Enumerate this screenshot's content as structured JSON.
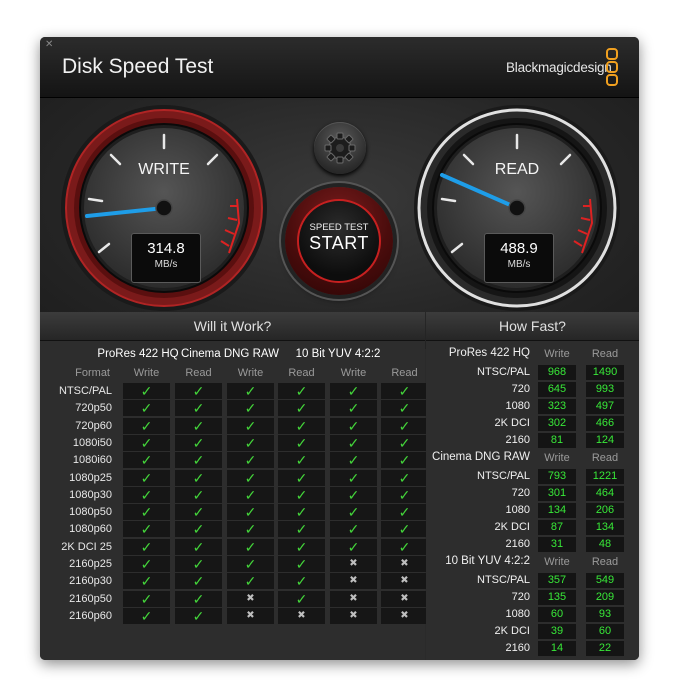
{
  "window": {
    "close_glyph": "✕",
    "title": "Disk Speed Test",
    "brand": "Blackmagicdesign"
  },
  "write_gauge": {
    "label": "WRITE",
    "value": "314.8",
    "unit": "MB/s"
  },
  "read_gauge": {
    "label": "READ",
    "value": "488.9",
    "unit": "MB/s"
  },
  "settings_button": {
    "icon": "gear-icon"
  },
  "start_button": {
    "top_label": "SPEED TEST",
    "label": "START"
  },
  "colors": {
    "accent_red": "#c62020",
    "needle": "#1e9de8",
    "ok_green": "#43d43a",
    "value_green": "#38e838"
  },
  "will_it_work": {
    "title": "Will it Work?",
    "format_header": "Format",
    "groups": [
      "ProRes 422 HQ",
      "Cinema DNG RAW",
      "10 Bit YUV 4:2:2"
    ],
    "subcols": [
      "Write",
      "Read",
      "Write",
      "Read",
      "Write",
      "Read"
    ],
    "check_glyph": "✓",
    "cross_glyph": "✖",
    "rows": [
      {
        "format": "NTSC/PAL",
        "results": [
          1,
          1,
          1,
          1,
          1,
          1
        ]
      },
      {
        "format": "720p50",
        "results": [
          1,
          1,
          1,
          1,
          1,
          1
        ]
      },
      {
        "format": "720p60",
        "results": [
          1,
          1,
          1,
          1,
          1,
          1
        ]
      },
      {
        "format": "1080i50",
        "results": [
          1,
          1,
          1,
          1,
          1,
          1
        ]
      },
      {
        "format": "1080i60",
        "results": [
          1,
          1,
          1,
          1,
          1,
          1
        ]
      },
      {
        "format": "1080p25",
        "results": [
          1,
          1,
          1,
          1,
          1,
          1
        ]
      },
      {
        "format": "1080p30",
        "results": [
          1,
          1,
          1,
          1,
          1,
          1
        ]
      },
      {
        "format": "1080p50",
        "results": [
          1,
          1,
          1,
          1,
          1,
          1
        ]
      },
      {
        "format": "1080p60",
        "results": [
          1,
          1,
          1,
          1,
          1,
          1
        ]
      },
      {
        "format": "2K DCI 25",
        "results": [
          1,
          1,
          1,
          1,
          1,
          1
        ]
      },
      {
        "format": "2160p25",
        "results": [
          1,
          1,
          1,
          1,
          0,
          0
        ]
      },
      {
        "format": "2160p30",
        "results": [
          1,
          1,
          1,
          1,
          0,
          0
        ]
      },
      {
        "format": "2160p50",
        "results": [
          1,
          1,
          0,
          1,
          0,
          0
        ]
      },
      {
        "format": "2160p60",
        "results": [
          1,
          1,
          0,
          0,
          0,
          0
        ]
      }
    ]
  },
  "how_fast": {
    "title": "How Fast?",
    "groups": [
      {
        "name": "ProRes 422 HQ",
        "write_label": "Write",
        "read_label": "Read",
        "rows": [
          {
            "format": "NTSC/PAL",
            "write": "968",
            "read": "1490"
          },
          {
            "format": "720",
            "write": "645",
            "read": "993"
          },
          {
            "format": "1080",
            "write": "323",
            "read": "497"
          },
          {
            "format": "2K DCI",
            "write": "302",
            "read": "466"
          },
          {
            "format": "2160",
            "write": "81",
            "read": "124"
          }
        ]
      },
      {
        "name": "Cinema DNG RAW",
        "write_label": "Write",
        "read_label": "Read",
        "rows": [
          {
            "format": "NTSC/PAL",
            "write": "793",
            "read": "1221"
          },
          {
            "format": "720",
            "write": "301",
            "read": "464"
          },
          {
            "format": "1080",
            "write": "134",
            "read": "206"
          },
          {
            "format": "2K DCI",
            "write": "87",
            "read": "134"
          },
          {
            "format": "2160",
            "write": "31",
            "read": "48"
          }
        ]
      },
      {
        "name": "10 Bit YUV 4:2:2",
        "write_label": "Write",
        "read_label": "Read",
        "rows": [
          {
            "format": "NTSC/PAL",
            "write": "357",
            "read": "549"
          },
          {
            "format": "720",
            "write": "135",
            "read": "209"
          },
          {
            "format": "1080",
            "write": "60",
            "read": "93"
          },
          {
            "format": "2K DCI",
            "write": "39",
            "read": "60"
          },
          {
            "format": "2160",
            "write": "14",
            "read": "22"
          }
        ]
      }
    ]
  }
}
